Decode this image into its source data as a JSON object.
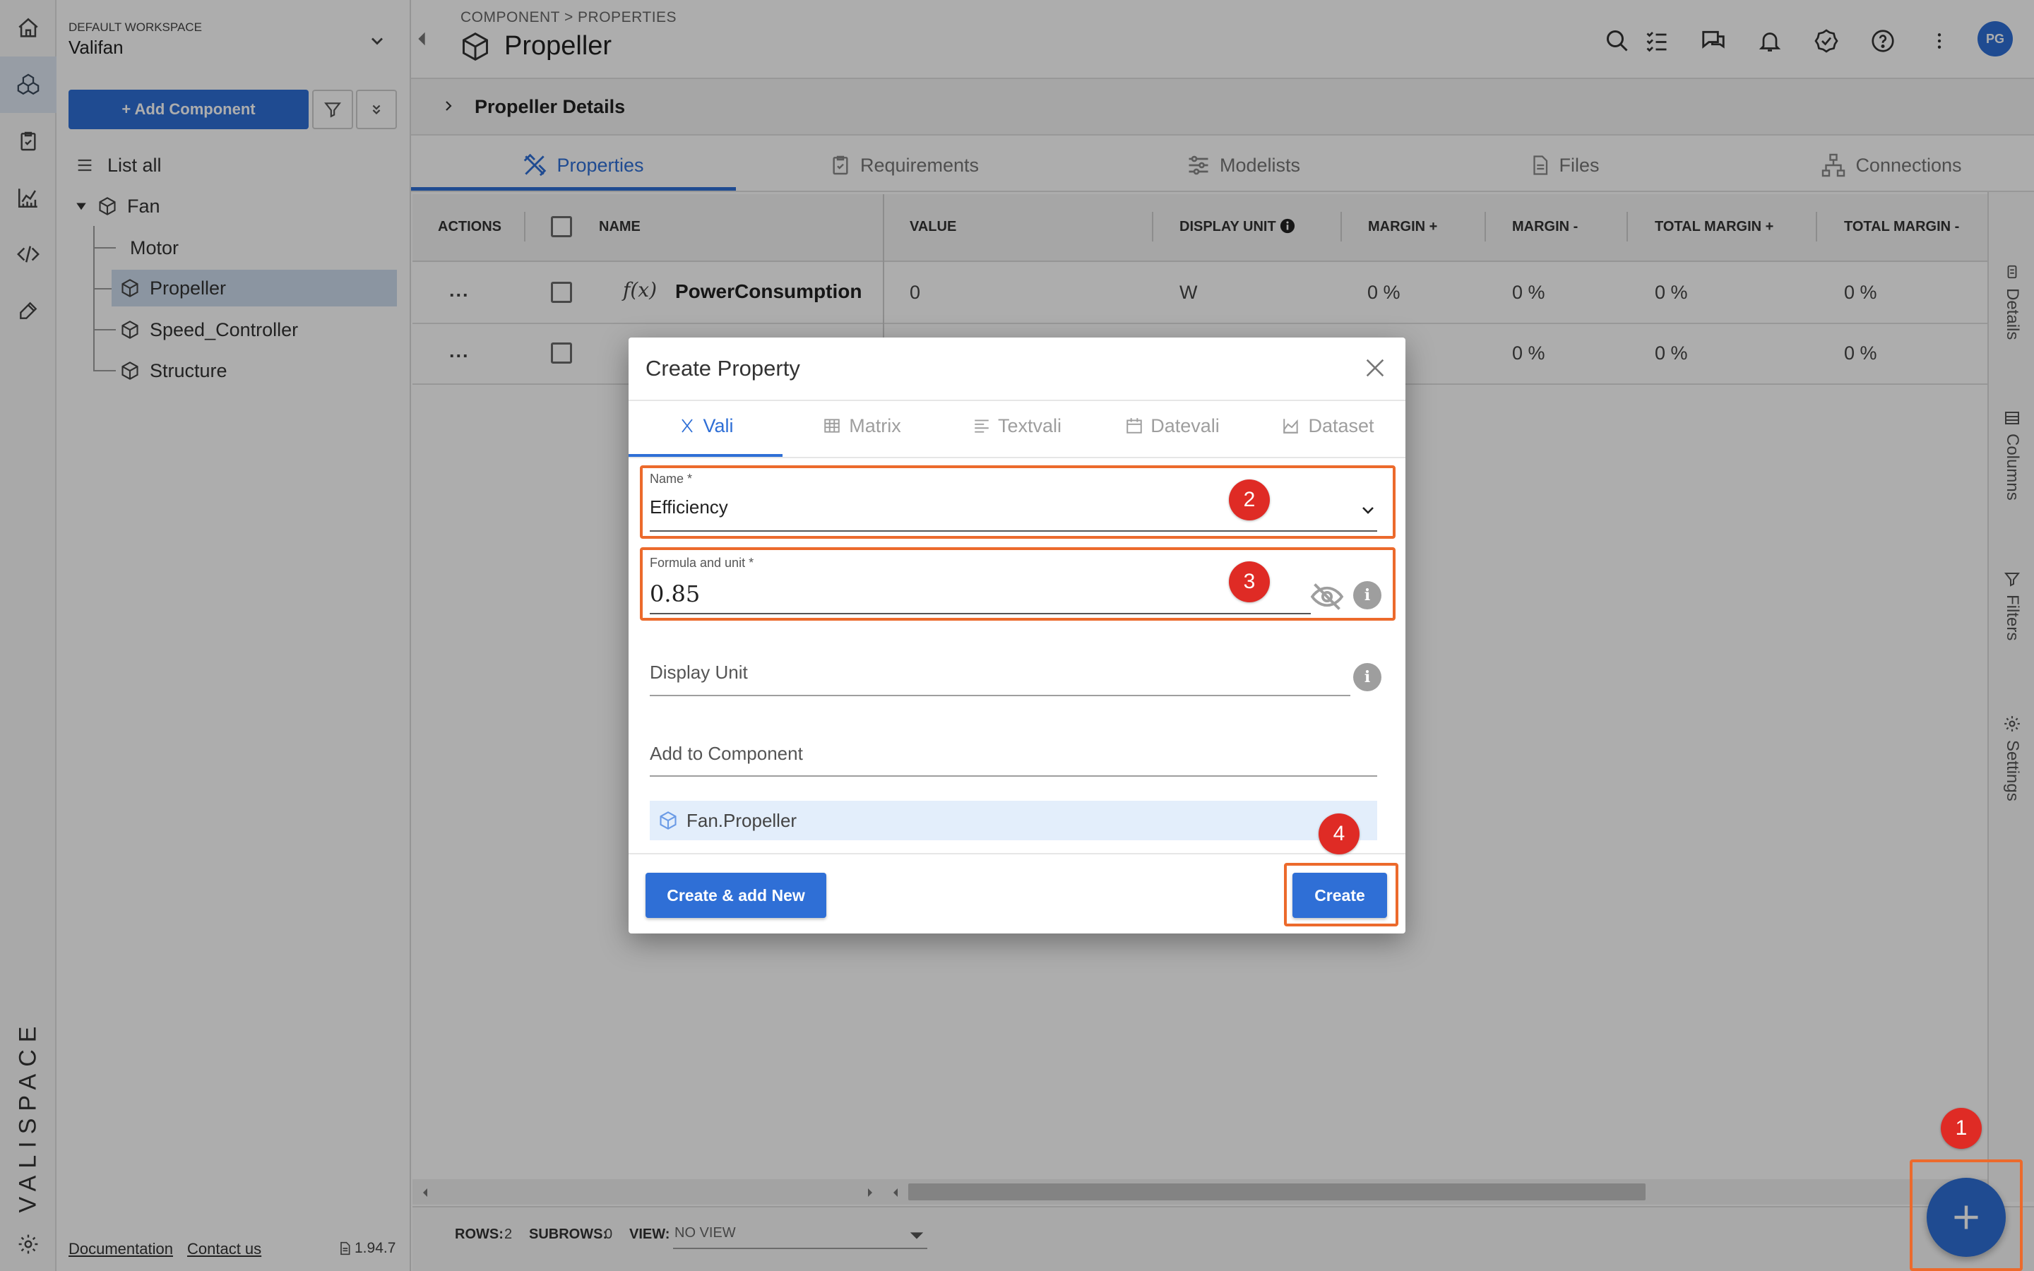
{
  "rail": {
    "items": [
      "home-icon",
      "components-icon",
      "requirements-icon",
      "analytics-icon",
      "code-icon",
      "tools-icon",
      "settings-icon"
    ],
    "brand": "VALISPACE"
  },
  "workspace": {
    "caption": "DEFAULT WORKSPACE",
    "name": "Valifan"
  },
  "tree": {
    "add_component_label": "+ Add Component",
    "list_all_label": "List all",
    "root": "Fan",
    "children": [
      "Motor",
      "Propeller",
      "Speed_Controller",
      "Structure"
    ],
    "selected": "Propeller"
  },
  "footer": {
    "documentation": "Documentation",
    "contact": "Contact us",
    "version": "1.94.7"
  },
  "header": {
    "breadcrumb": "COMPONENT > PROPERTIES",
    "title": "Propeller",
    "avatar": "PG"
  },
  "details": {
    "label": "Propeller Details"
  },
  "tabs": [
    "Properties",
    "Requirements",
    "Modelists",
    "Files",
    "Connections"
  ],
  "grid": {
    "columns": [
      "ACTIONS",
      "NAME",
      "VALUE",
      "DISPLAY UNIT",
      "MARGIN +",
      "MARGIN -",
      "TOTAL MARGIN +",
      "TOTAL MARGIN -"
    ],
    "rows": [
      {
        "actions": "...",
        "name": "PowerConsumption",
        "value": "0",
        "unit": "W",
        "margin_plus": "0 %",
        "margin_minus": "0 %",
        "total_plus": "0 %",
        "total_minus": "0 %"
      },
      {
        "actions": "...",
        "name": "",
        "value": "",
        "unit": "",
        "margin_plus": "0 %",
        "margin_minus": "0 %",
        "total_plus": "0 %",
        "total_minus": "0 %"
      }
    ],
    "fx_symbol": "f(x)"
  },
  "side_tabs": [
    "Details",
    "Columns",
    "Filters",
    "Settings"
  ],
  "status": {
    "rows_label": "ROWS:",
    "rows_value": "2",
    "subrows_label": "SUBROWS:",
    "subrows_value": "0",
    "view_label": "VIEW:",
    "view_value": "NO VIEW"
  },
  "dialog": {
    "title": "Create Property",
    "tabs": [
      "Vali",
      "Matrix",
      "Textvali",
      "Datevali",
      "Dataset"
    ],
    "name_label": "Name *",
    "name_value": "Efficiency",
    "formula_label": "Formula and unit *",
    "formula_value": "0.85",
    "display_unit_placeholder": "Display Unit",
    "add_to_component_placeholder": "Add to Component",
    "component_chip": "Fan.Propeller",
    "create_add_new_label": "Create & add New",
    "create_label": "Create"
  },
  "annotations": [
    "1",
    "2",
    "3",
    "4"
  ],
  "colors": {
    "accent": "#2f6fd6",
    "highlight": "#ec6a2c",
    "badge": "#df2b25"
  }
}
